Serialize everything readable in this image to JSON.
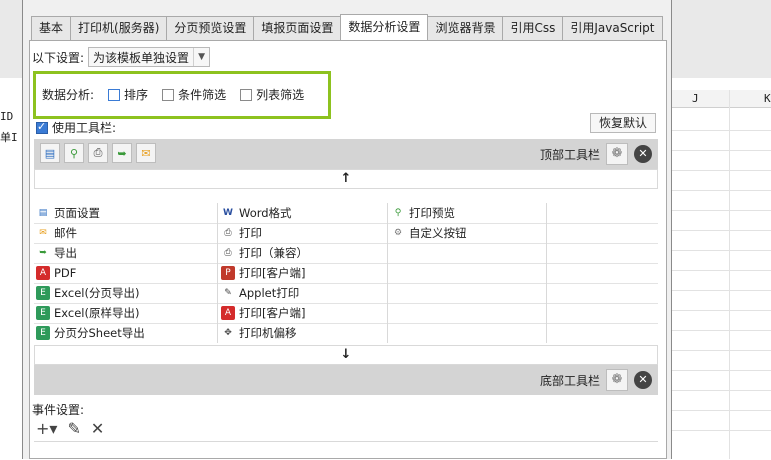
{
  "tabs": [
    "基本",
    "打印机(服务器)",
    "分页预览设置",
    "填报页面设置",
    "数据分析设置",
    "浏览器背景",
    "引用Css",
    "引用JavaScript"
  ],
  "active_tab": "数据分析设置",
  "settings": {
    "label": "以下设置:",
    "combo_value": "为该模板单独设置"
  },
  "data_analysis": {
    "label": "数据分析:",
    "options": [
      "排序",
      "条件筛选",
      "列表筛选"
    ]
  },
  "toolbar_check": {
    "label": "使用工具栏:"
  },
  "restore_button": "恢复默认",
  "top_bar": {
    "label": "顶部工具栏"
  },
  "bottom_bar": {
    "label": "底部工具栏"
  },
  "arrows": {
    "up": "↑",
    "down": "↓"
  },
  "items": {
    "col1": [
      "页面设置",
      "邮件",
      "导出",
      "PDF",
      "Excel(分页导出)",
      "Excel(原样导出)",
      "分页分Sheet导出"
    ],
    "col2": [
      "Word格式",
      "打印",
      "打印（兼容）",
      "打印[客户端]",
      "Applet打印",
      "打印[客户端]",
      "打印机偏移"
    ],
    "col3": [
      "打印预览",
      "自定义按钮"
    ]
  },
  "events": {
    "label": "事件设置:"
  },
  "background": {
    "col_j": "J",
    "col_k": "K",
    "left_text_1": "ID",
    "left_text_2": "单I"
  },
  "colors": {
    "highlight": "#8dc21f",
    "accent": "#3a7bd5"
  }
}
